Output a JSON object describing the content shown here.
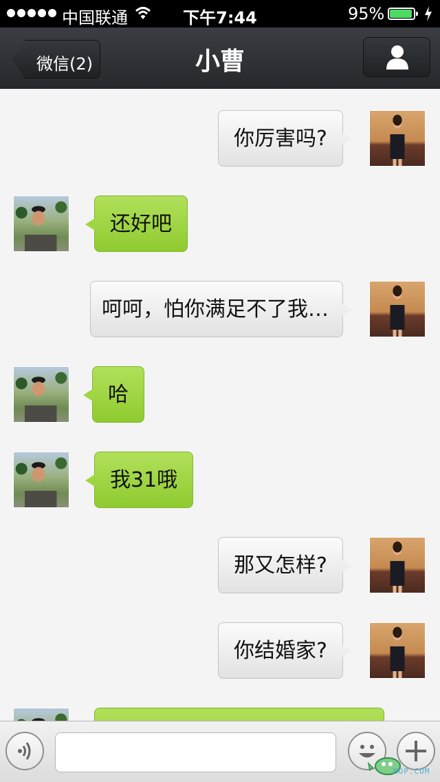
{
  "status_bar": {
    "carrier": "中国联通",
    "time": "下午7:44",
    "battery_percent": "95%",
    "battery_level": 0.95,
    "signal_bars": 5
  },
  "nav_bar": {
    "back_label": "微信(2)",
    "title": "小曹",
    "profile_icon": "person-icon"
  },
  "messages": [
    {
      "direction": "out",
      "text": "你厉害吗?"
    },
    {
      "direction": "in",
      "text": "还好吧"
    },
    {
      "direction": "out",
      "text": "呵呵，怕你满足不了我…"
    },
    {
      "direction": "in",
      "text": "哈"
    },
    {
      "direction": "in",
      "text": "我31哦"
    },
    {
      "direction": "out",
      "text": "那又怎样?"
    },
    {
      "direction": "out",
      "text": "你结婚家?"
    },
    {
      "direction": "in",
      "text": ""
    }
  ],
  "input_bar": {
    "voice_icon": "voice-icon",
    "input_value": "",
    "input_placeholder": "",
    "emoji_icon": "emoji-icon",
    "plus_icon": "plus-icon"
  },
  "watermark": {
    "text": "MOP.COM"
  },
  "colors": {
    "incoming_bubble": "#9fd544",
    "outgoing_bubble": "#eeeeee",
    "nav_bar": "#2f3337",
    "battery": "#4cd964"
  }
}
